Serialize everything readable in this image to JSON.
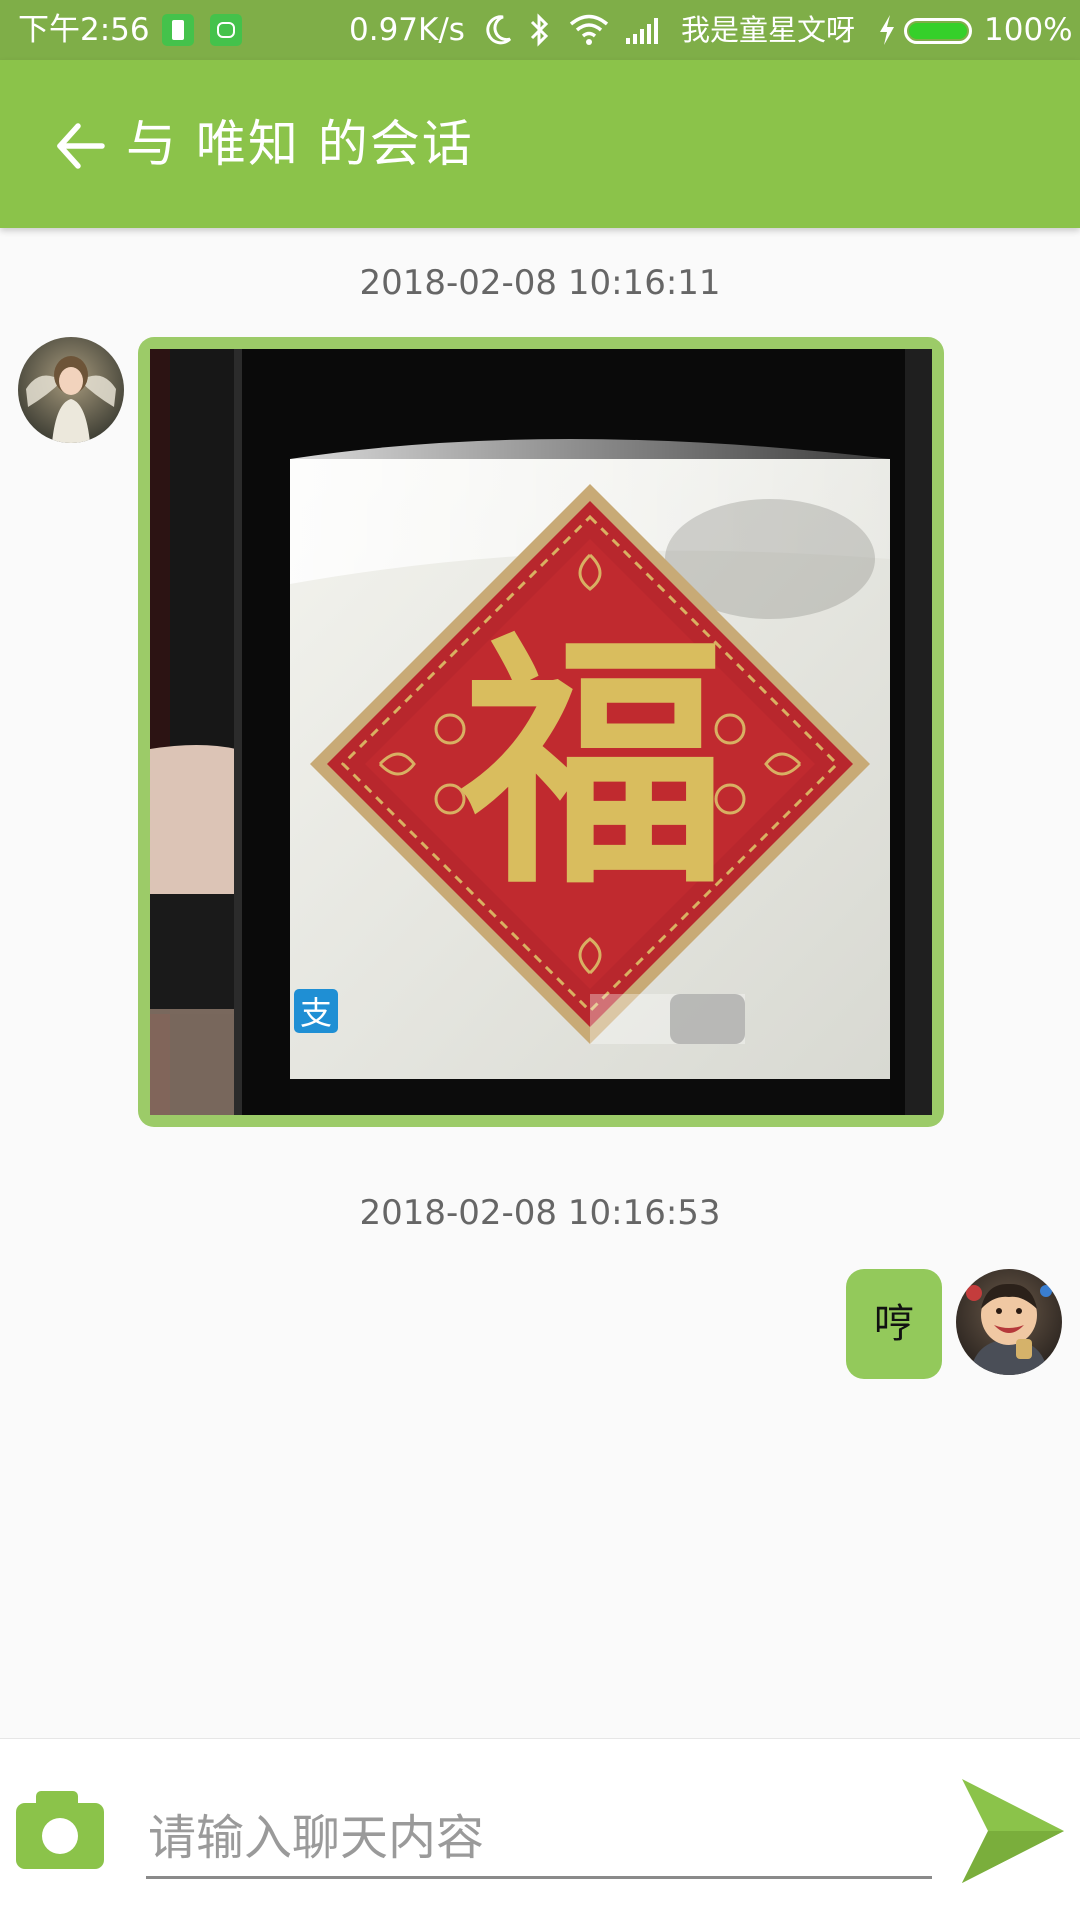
{
  "status_bar": {
    "time": "下午2:56",
    "net_speed": "0.97K/s",
    "carrier": "我是童星文呀",
    "battery_percent": "100%",
    "icons": [
      "battery-saver-icon",
      "android-face-icon",
      "moon-icon",
      "bluetooth-icon",
      "wifi-icon",
      "signal-icon",
      "charging-icon",
      "battery-icon"
    ]
  },
  "header": {
    "title": "与 唯知 的会话",
    "back_icon": "arrow-left-icon"
  },
  "messages": [
    {
      "timestamp": "2018-02-08 10:16:11",
      "direction": "incoming",
      "type": "image",
      "image_content": "福"
    },
    {
      "timestamp": "2018-02-08 10:16:53",
      "direction": "outgoing",
      "type": "text",
      "text": "哼"
    }
  ],
  "composer": {
    "placeholder": "请输入聊天内容",
    "value": "",
    "camera_icon": "camera-icon",
    "send_icon": "send-icon"
  },
  "colors": {
    "status_bar": "#7fae48",
    "app_bar": "#8bc34a",
    "bubble": "#93c95b",
    "background": "#fafafa"
  }
}
